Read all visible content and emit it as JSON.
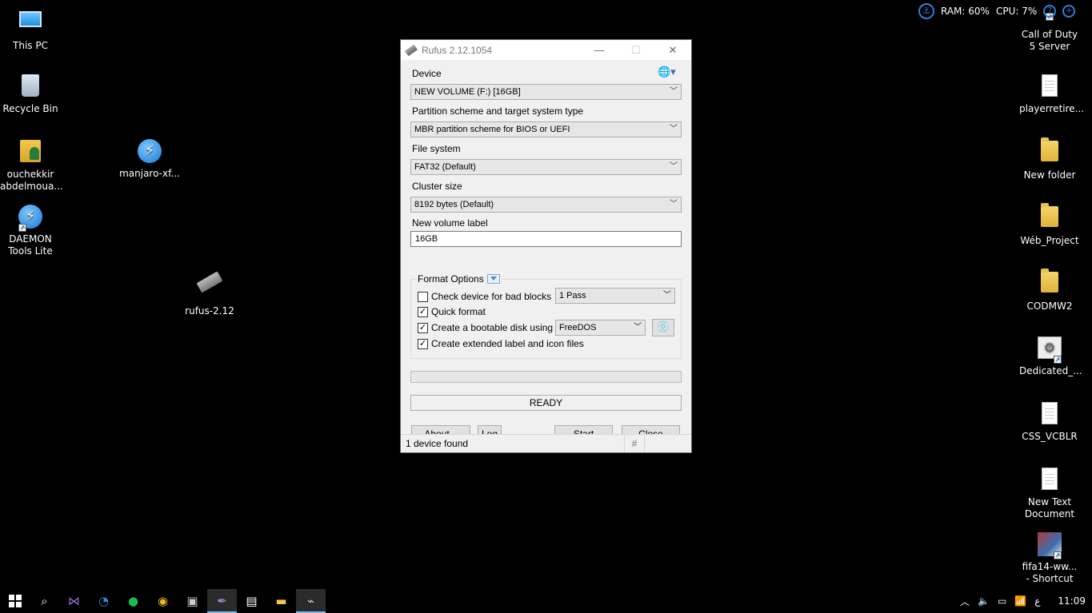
{
  "desktop": {
    "left_icons": [
      {
        "label": "This PC"
      },
      {
        "label": "Recycle Bin"
      },
      {
        "label": "ouchekkir abdelmoua..."
      },
      {
        "label": "manjaro-xf..."
      },
      {
        "label": "DAEMON Tools Lite"
      },
      {
        "label": "rufus-2.12"
      }
    ],
    "right_icons": [
      {
        "label": "Call of Duty 5 Server"
      },
      {
        "label": "playerretire..."
      },
      {
        "label": "New folder"
      },
      {
        "label": "Wéb_Project"
      },
      {
        "label": "CODMW2"
      },
      {
        "label": "Dedicated_..."
      },
      {
        "label": "CSS_VCBLR"
      },
      {
        "label": "New Text Document"
      },
      {
        "label": "fifa14-ww... - Shortcut"
      }
    ]
  },
  "widget": {
    "ram": "RAM: 60%",
    "cpu": "CPU: 7%"
  },
  "window": {
    "title": "Rufus 2.12.1054",
    "device_label": "Device",
    "device_value": "NEW VOLUME (F:) [16GB]",
    "partition_label": "Partition scheme and target system type",
    "partition_value": "MBR partition scheme for BIOS or UEFI",
    "fs_label": "File system",
    "fs_value": "FAT32 (Default)",
    "cluster_label": "Cluster size",
    "cluster_value": "8192 bytes (Default)",
    "volume_label": "New volume label",
    "volume_value": "16GB",
    "format_options": "Format Options",
    "check_bad_blocks": "Check device for bad blocks",
    "passes": "1 Pass",
    "quick_format": "Quick format",
    "bootable": "Create a bootable disk using",
    "boot_type": "FreeDOS",
    "extended_label": "Create extended label and icon files",
    "progress": 0,
    "status": "READY",
    "about": "About...",
    "log": "Log",
    "start": "Start",
    "close": "Close",
    "statusbar": "1 device found",
    "hash": "#"
  },
  "taskbar": {
    "time": "11:09",
    "lang": "ع"
  }
}
